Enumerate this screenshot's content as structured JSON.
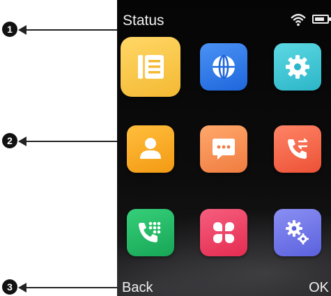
{
  "callouts": [
    {
      "number": "1",
      "target": "status bar"
    },
    {
      "number": "2",
      "target": "menu icons"
    },
    {
      "number": "3",
      "target": "softkeys"
    }
  ],
  "status_bar": {
    "title": "Status",
    "icons": [
      "wifi-icon",
      "battery-icon"
    ],
    "battery_level": 0.7
  },
  "menu": {
    "items": [
      {
        "icon": "directory-list-icon",
        "color": "#f7c645",
        "selected": true
      },
      {
        "icon": "globe-icon",
        "color": "#2f7bea"
      },
      {
        "icon": "gear-icon",
        "color": "#3fc6d4"
      },
      {
        "icon": "contact-person-icon",
        "color": "#f5a623"
      },
      {
        "icon": "message-chat-icon",
        "color": "#f58d55"
      },
      {
        "icon": "call-forward-icon",
        "color": "#f46a4e"
      },
      {
        "icon": "dialpad-phone-icon",
        "color": "#24b866"
      },
      {
        "icon": "apps-grid-icon",
        "color": "#ee3f63"
      },
      {
        "icon": "settings-gears-icon",
        "color": "#6f75e8"
      }
    ]
  },
  "softkeys": {
    "left": "Back",
    "right": "OK"
  },
  "colors": {
    "screen_bg": "#0a0a0a",
    "text": "#f2f2f2",
    "callout": "#111111"
  }
}
